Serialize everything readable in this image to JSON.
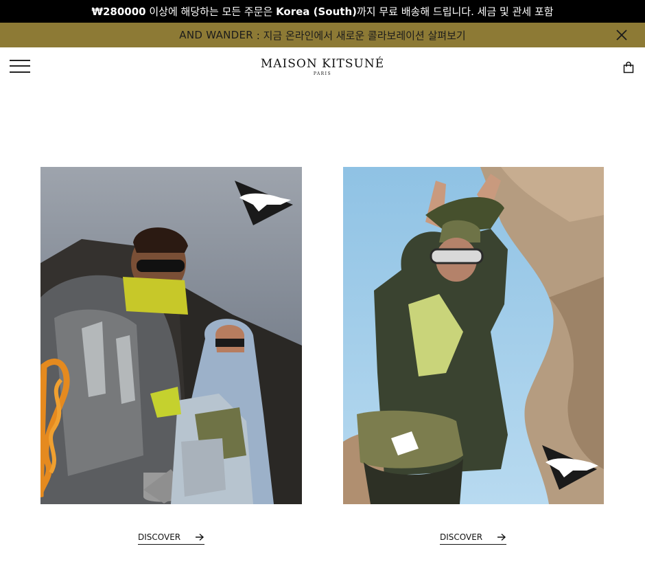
{
  "announcement": {
    "amount": "₩280000",
    "text_before": " 이상에 해당하는 모든 주문은 ",
    "country": "Korea (South)",
    "text_after": "까지 무료 배송해 드립니다. 세금 및 관세 포함"
  },
  "promo": {
    "brand": "AND WANDER",
    "text": " : 지금 온라인에서 새로운 콜라보레이션 살펴보기"
  },
  "header": {
    "logo_name": "MAISON KITSUNÉ",
    "logo_city": "PARIS"
  },
  "cards": [
    {
      "cta_label": "DISCOVER"
    },
    {
      "cta_label": "DISCOVER"
    }
  ],
  "colors": {
    "announcement_bg": "#000000",
    "promo_bg": "#8d7a35",
    "page_bg": "#ffffff"
  },
  "icons": [
    "menu-icon",
    "close-icon",
    "shopping-bag-icon",
    "arrow-right-icon",
    "and-wander-fox-logo"
  ]
}
